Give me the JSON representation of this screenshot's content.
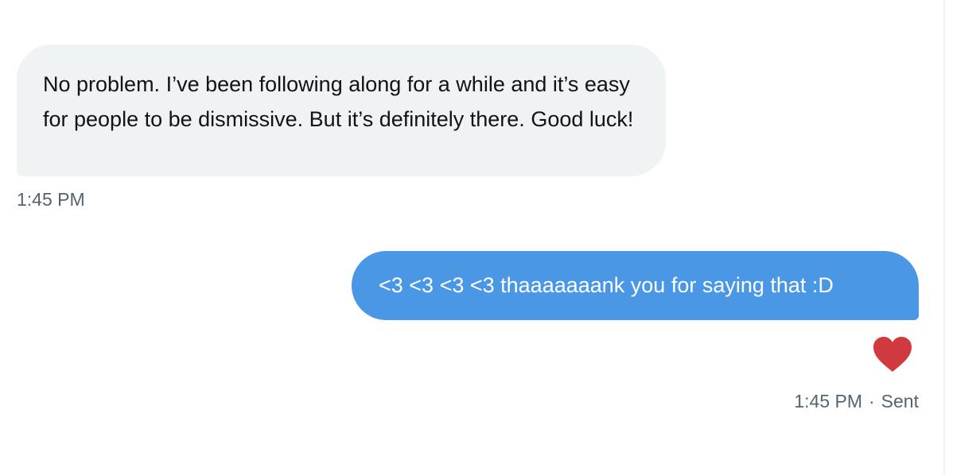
{
  "conversation": {
    "received_message": {
      "text": "No problem. I’ve been following along for a while and it’s easy for people to be dismissive. But it’s definitely there. Good luck!",
      "timestamp": "1:45 PM",
      "bubble_color": "#eff3f4"
    },
    "sent_message": {
      "text": "<3 <3 <3 <3 thaaaaaaank you for saying that :D",
      "timestamp": "1:45 PM",
      "separator": "·",
      "status": "Sent",
      "bubble_color": "#4a97e5",
      "reaction_icon": "heart-icon",
      "reaction_color": "#d0393e"
    }
  }
}
